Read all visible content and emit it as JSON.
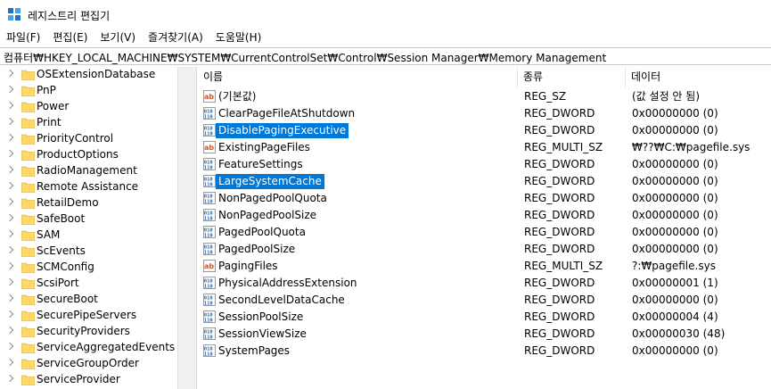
{
  "window": {
    "title": "레지스트리 편집기"
  },
  "menu": [
    "파일(F)",
    "편집(E)",
    "보기(V)",
    "즐겨찾기(A)",
    "도움말(H)"
  ],
  "address": "컴퓨터₩HKEY_LOCAL_MACHINE₩SYSTEM₩CurrentControlSet₩Control₩Session Manager₩Memory Management",
  "tree": {
    "items": [
      "OSExtensionDatabase",
      "PnP",
      "Power",
      "Print",
      "PriorityControl",
      "ProductOptions",
      "RadioManagement",
      "Remote Assistance",
      "RetailDemo",
      "SafeBoot",
      "SAM",
      "ScEvents",
      "SCMConfig",
      "ScsiPort",
      "SecureBoot",
      "SecurePipeServers",
      "SecurityProviders",
      "ServiceAggregatedEvents",
      "ServiceGroupOrder",
      "ServiceProvider"
    ]
  },
  "columns": {
    "name": "이름",
    "type": "종류",
    "data": "데이터"
  },
  "values": [
    {
      "name": "(기본값)",
      "type": "REG_SZ",
      "data": "(값 설정 안 됨)",
      "icon": "string-value-icon",
      "selected": false
    },
    {
      "name": "ClearPageFileAtShutdown",
      "type": "REG_DWORD",
      "data": "0x00000000 (0)",
      "icon": "binary-value-icon",
      "selected": false
    },
    {
      "name": "DisablePagingExecutive",
      "type": "REG_DWORD",
      "data": "0x00000000 (0)",
      "icon": "binary-value-icon",
      "selected": true
    },
    {
      "name": "ExistingPageFiles",
      "type": "REG_MULTI_SZ",
      "data": "₩??₩C:₩pagefile.sys",
      "icon": "string-value-icon",
      "selected": false
    },
    {
      "name": "FeatureSettings",
      "type": "REG_DWORD",
      "data": "0x00000000 (0)",
      "icon": "binary-value-icon",
      "selected": false
    },
    {
      "name": "LargeSystemCache",
      "type": "REG_DWORD",
      "data": "0x00000000 (0)",
      "icon": "binary-value-icon",
      "selected": true
    },
    {
      "name": "NonPagedPoolQuota",
      "type": "REG_DWORD",
      "data": "0x00000000 (0)",
      "icon": "binary-value-icon",
      "selected": false
    },
    {
      "name": "NonPagedPoolSize",
      "type": "REG_DWORD",
      "data": "0x00000000 (0)",
      "icon": "binary-value-icon",
      "selected": false
    },
    {
      "name": "PagedPoolQuota",
      "type": "REG_DWORD",
      "data": "0x00000000 (0)",
      "icon": "binary-value-icon",
      "selected": false
    },
    {
      "name": "PagedPoolSize",
      "type": "REG_DWORD",
      "data": "0x00000000 (0)",
      "icon": "binary-value-icon",
      "selected": false
    },
    {
      "name": "PagingFiles",
      "type": "REG_MULTI_SZ",
      "data": "?:₩pagefile.sys",
      "icon": "string-value-icon",
      "selected": false
    },
    {
      "name": "PhysicalAddressExtension",
      "type": "REG_DWORD",
      "data": "0x00000001 (1)",
      "icon": "binary-value-icon",
      "selected": false
    },
    {
      "name": "SecondLevelDataCache",
      "type": "REG_DWORD",
      "data": "0x00000000 (0)",
      "icon": "binary-value-icon",
      "selected": false
    },
    {
      "name": "SessionPoolSize",
      "type": "REG_DWORD",
      "data": "0x00000004 (4)",
      "icon": "binary-value-icon",
      "selected": false
    },
    {
      "name": "SessionViewSize",
      "type": "REG_DWORD",
      "data": "0x00000030 (48)",
      "icon": "binary-value-icon",
      "selected": false
    },
    {
      "name": "SystemPages",
      "type": "REG_DWORD",
      "data": "0x00000000 (0)",
      "icon": "binary-value-icon",
      "selected": false
    }
  ],
  "colors": {
    "selection": "#0078d7",
    "folder": "#ffd766",
    "string_icon": "#d9531e",
    "binary_icon": "#1f5fa8"
  }
}
